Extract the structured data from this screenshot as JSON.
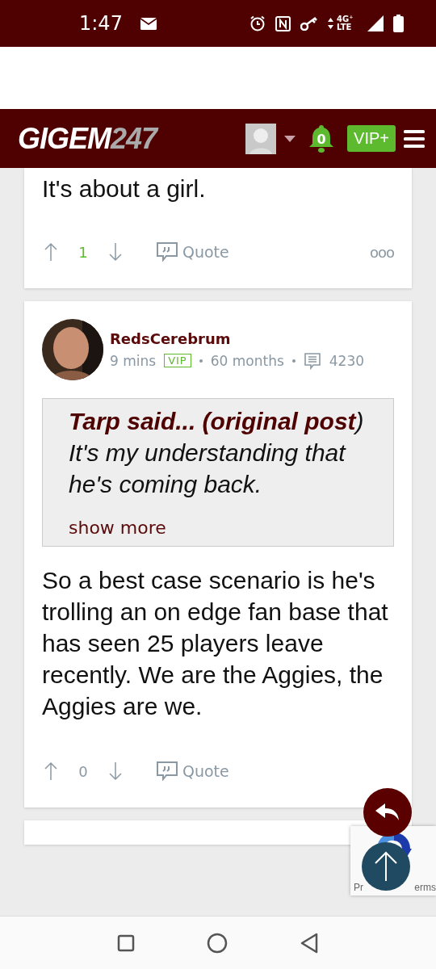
{
  "status_bar": {
    "time": "1:47",
    "network": "4G⁺ LTE"
  },
  "header": {
    "logo_main": "GIGEM",
    "logo_accent": "247",
    "notifications": "0",
    "vip_button": "VIP+"
  },
  "posts": [
    {
      "kind": "partial",
      "body": "It's about a girl.",
      "votes": "1",
      "votes_positive": true,
      "quote_label": "Quote",
      "more_menu": "ooo"
    },
    {
      "kind": "full",
      "author": "RedsCerebrum",
      "time": "9 mins",
      "badge": "VIP",
      "tenure": "60 months",
      "post_count": "4230",
      "quote": {
        "text": "**Tarp said... (original post**) It's my understanding that he's coming back.",
        "show_more": "show more"
      },
      "body": "So a best case scenario is he's trolling an on edge fan base that has seen 25 players leave recently. We are the Aggies, the Aggies are we.",
      "votes": "0",
      "votes_positive": false,
      "quote_label": "Quote"
    }
  ],
  "recaptcha": {
    "text_left": "Pr",
    "text_right": "erms"
  }
}
